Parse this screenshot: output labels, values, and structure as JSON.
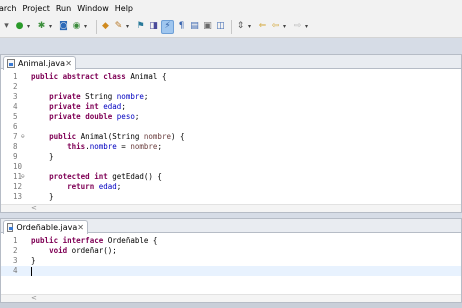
{
  "menu": [
    "arch",
    "Project",
    "Run",
    "Window",
    "Help"
  ],
  "toolbar_icons": [
    "new-icon",
    "run-icon",
    "debug-icon",
    "open-type-icon",
    "build-icon",
    "search-icon",
    "pen-icon",
    "bookmark-icon",
    "toggle-mark-icon",
    "split-icon",
    "outline-icon",
    "ant-icon",
    "window-icon",
    "next-annotation-icon",
    "last-edit-icon",
    "back-icon",
    "forward-icon"
  ],
  "editor_top": {
    "tab_label": "Animal.java",
    "lines": [
      {
        "n": "1",
        "text": "public abstract class Animal {"
      },
      {
        "n": "2",
        "text": ""
      },
      {
        "n": "3",
        "text": "    private String nombre;"
      },
      {
        "n": "4",
        "text": "    private int edad;"
      },
      {
        "n": "5",
        "text": "    private double peso;"
      },
      {
        "n": "6",
        "text": ""
      },
      {
        "n": "7",
        "text": "    public Animal(String nombre) {"
      },
      {
        "n": "8",
        "text": "        this.nombre = nombre;"
      },
      {
        "n": "9",
        "text": "    }"
      },
      {
        "n": "10",
        "text": ""
      },
      {
        "n": "11",
        "text": "    protected int getEdad() {"
      },
      {
        "n": "12",
        "text": "        return edad;"
      },
      {
        "n": "13",
        "text": "    }"
      }
    ]
  },
  "editor_bottom": {
    "tab_label": "Ordeñable.java",
    "lines": [
      {
        "n": "1",
        "text": "public interface Ordeñable {"
      },
      {
        "n": "2",
        "text": "    void ordeñar();"
      },
      {
        "n": "3",
        "text": "}"
      },
      {
        "n": "4",
        "text": ""
      }
    ]
  }
}
